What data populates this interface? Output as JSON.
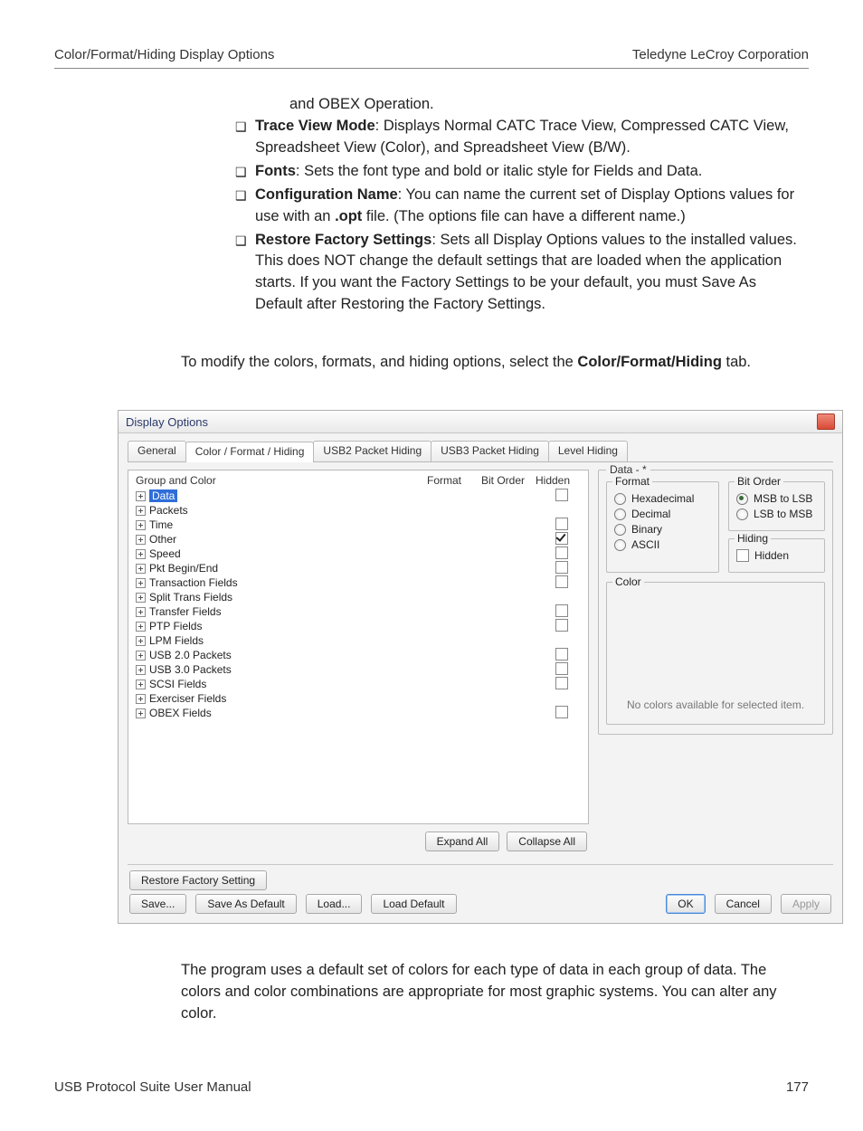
{
  "header": {
    "left": "Color/Format/Hiding Display Options",
    "right": "Teledyne  LeCroy Corporation"
  },
  "intro_cont": "and OBEX Operation.",
  "bullets": [
    {
      "term": "Trace View Mode",
      "rest": ": Displays Normal CATC Trace View, Compressed CATC View, Spreadsheet View (Color), and Spreadsheet View (B/W)."
    },
    {
      "term": "Fonts",
      "rest": ": Sets the font type and bold or italic style for Fields and Data."
    },
    {
      "term": "Configuration Name",
      "rest": ": You can name the current set of Display Options values for use with an ",
      "boldmid": ".opt",
      "rest2": " file. (The options file can have a different name.)"
    },
    {
      "term": "Restore Factory Settings",
      "rest": ": Sets all Display Options values to the installed values. This does NOT change the default settings that are loaded when the application starts. If you want the Factory Settings to be your default, you must Save As Default after Restoring the Factory Settings."
    }
  ],
  "para1_pre": "To modify the colors, formats, and hiding options, select the ",
  "para1_bold": "Color/Format/Hiding",
  "para1_post": " tab.",
  "dialog": {
    "title": "Display Options",
    "tabs": [
      "General",
      "Color / Format / Hiding",
      "USB2 Packet Hiding",
      "USB3 Packet Hiding",
      "Level Hiding"
    ],
    "active_tab": 1,
    "tree_headers": {
      "group": "Group and Color",
      "format": "Format",
      "bitorder": "Bit Order",
      "hidden": "Hidden"
    },
    "tree": [
      {
        "label": "Data",
        "selected": true,
        "hidden_cb": true,
        "checked": false
      },
      {
        "label": "Packets",
        "hidden_cb": false
      },
      {
        "label": "Time",
        "hidden_cb": true,
        "checked": false
      },
      {
        "label": "Other",
        "hidden_cb": true,
        "checked": true
      },
      {
        "label": "Speed",
        "hidden_cb": true,
        "checked": false
      },
      {
        "label": "Pkt Begin/End",
        "hidden_cb": true,
        "checked": false
      },
      {
        "label": "Transaction Fields",
        "hidden_cb": true,
        "checked": false
      },
      {
        "label": "Split Trans Fields",
        "hidden_cb": false
      },
      {
        "label": "Transfer Fields",
        "hidden_cb": true,
        "checked": false
      },
      {
        "label": "PTP Fields",
        "hidden_cb": true,
        "checked": false
      },
      {
        "label": "LPM Fields",
        "hidden_cb": false
      },
      {
        "label": "USB 2.0 Packets",
        "hidden_cb": true,
        "checked": false
      },
      {
        "label": "USB 3.0 Packets",
        "hidden_cb": true,
        "checked": false
      },
      {
        "label": "SCSI Fields",
        "hidden_cb": true,
        "checked": false
      },
      {
        "label": "Exerciser Fields",
        "hidden_cb": false
      },
      {
        "label": "OBEX Fields",
        "hidden_cb": true,
        "checked": false
      }
    ],
    "expand_all": "Expand All",
    "collapse_all": "Collapse All",
    "detail_title": "Data - *",
    "format_group": "Format",
    "format_opts": [
      "Hexadecimal",
      "Decimal",
      "Binary",
      "ASCII"
    ],
    "bitorder_group": "Bit Order",
    "bitorder_opts": [
      "MSB to LSB",
      "LSB to MSB"
    ],
    "bitorder_selected": 0,
    "hiding_group": "Hiding",
    "hiding_label": "Hidden",
    "color_group": "Color",
    "color_msg": "No colors available for selected item.",
    "restore": "Restore Factory Setting",
    "save": "Save...",
    "save_default": "Save As Default",
    "load": "Load...",
    "load_default": "Load Default",
    "ok": "OK",
    "cancel": "Cancel",
    "apply": "Apply"
  },
  "para2": "The program uses a default set of colors for each type of data in each group of data. The colors and color combinations are appropriate for most graphic systems. You can alter any color.",
  "footer": {
    "left": "USB Protocol Suite User Manual",
    "right": "177"
  }
}
